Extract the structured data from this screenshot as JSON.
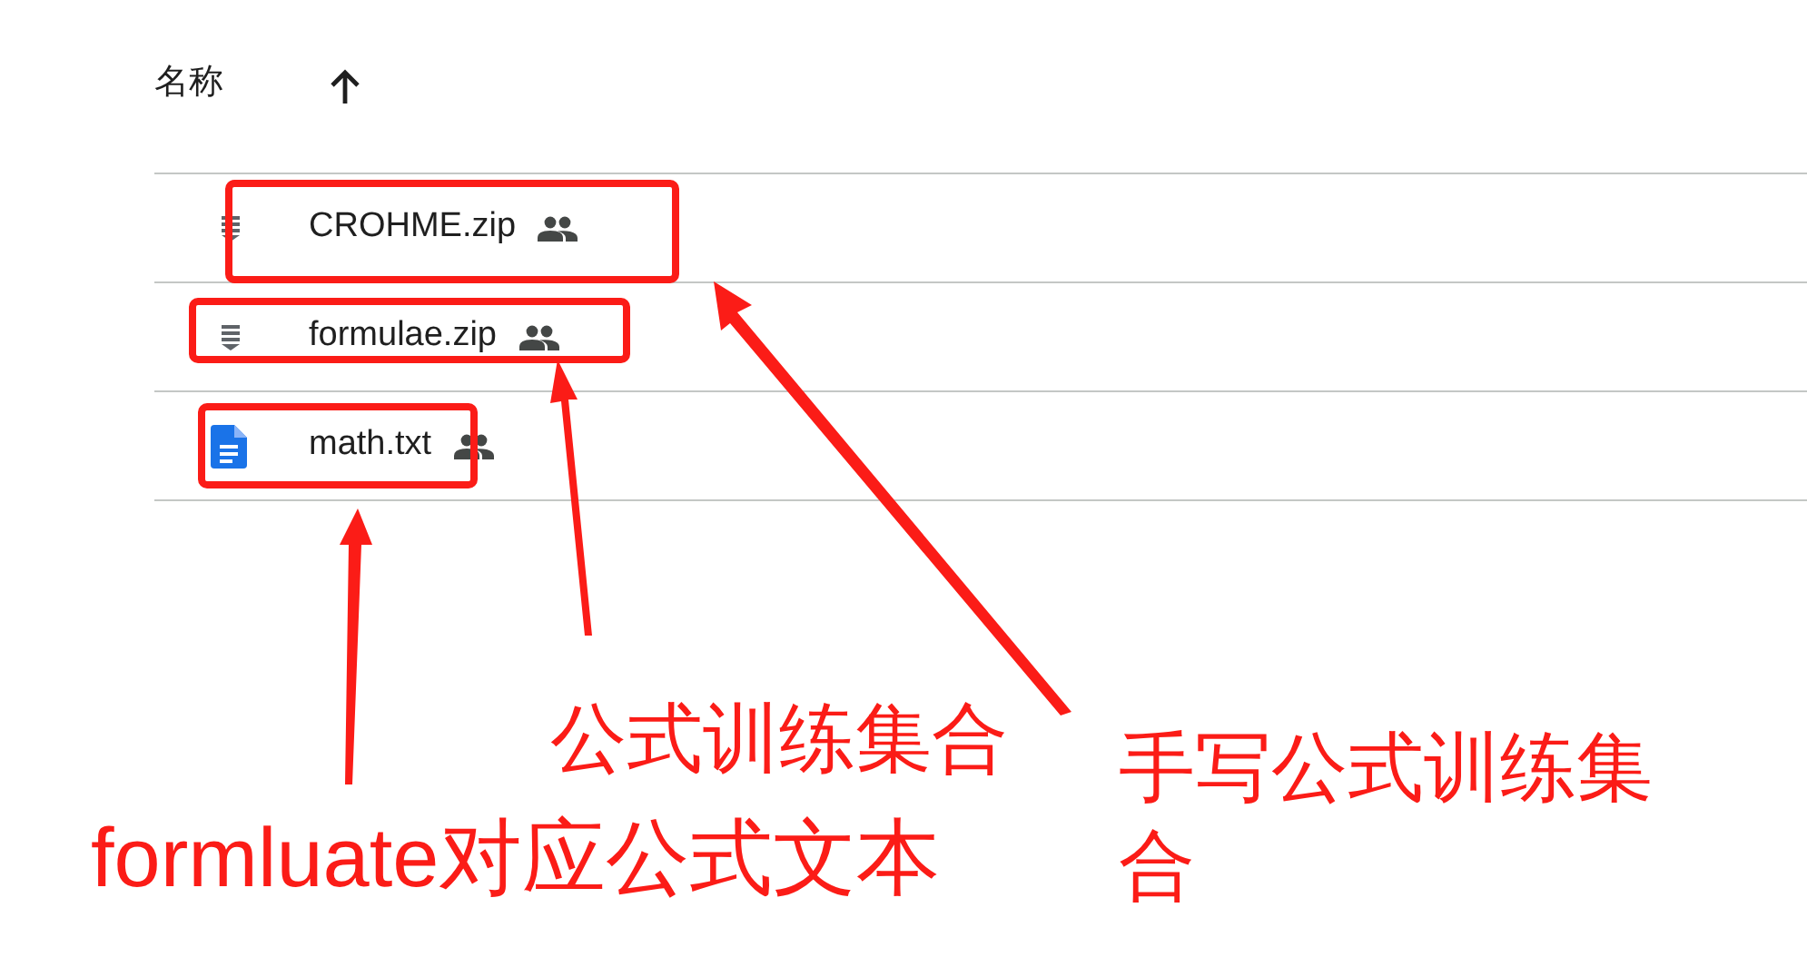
{
  "header": {
    "column_label": "名称"
  },
  "files": [
    {
      "name": "CROHME.zip",
      "kind": "zip",
      "shared": true
    },
    {
      "name": "formulae.zip",
      "kind": "zip",
      "shared": true
    },
    {
      "name": "math.txt",
      "kind": "doc",
      "shared": true
    }
  ],
  "annotations": [
    {
      "text": "公式训练集合"
    },
    {
      "text": "formluate对应公式文本"
    },
    {
      "text": "手写公式训练集合"
    }
  ]
}
